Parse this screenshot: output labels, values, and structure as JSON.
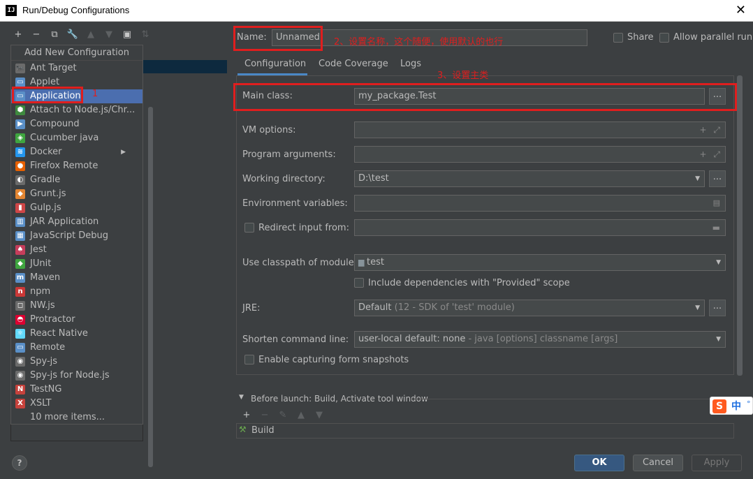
{
  "window": {
    "title": "Run/Debug Configurations",
    "logo": "IJ",
    "close_glyph": "✕"
  },
  "toolbar": {
    "icons": [
      {
        "name": "add-icon",
        "glyph": "+"
      },
      {
        "name": "remove-icon",
        "glyph": "−"
      },
      {
        "name": "copy-icon",
        "glyph": "⧉"
      },
      {
        "name": "wrench-icon",
        "glyph": "🔧"
      },
      {
        "name": "move-up-icon",
        "glyph": "▲"
      },
      {
        "name": "move-down-icon",
        "glyph": "▼"
      },
      {
        "name": "new-folder-icon",
        "glyph": "▣"
      },
      {
        "name": "sort-icon",
        "glyph": "⇅"
      }
    ]
  },
  "popup": {
    "header": "Add New Configuration",
    "items": [
      {
        "label": "Ant Target",
        "icon": "ant-icon",
        "glyph": "🐜",
        "color": "#6b6b6b"
      },
      {
        "label": "Applet",
        "icon": "applet-icon",
        "glyph": "▭",
        "color": "#5a8fc7"
      },
      {
        "label": "Application",
        "icon": "application-icon",
        "glyph": "▭",
        "color": "#5a8fc7"
      },
      {
        "label": "Attach to Node.js/Chr...",
        "icon": "attach-node-icon",
        "glyph": "⬢",
        "color": "#3f8a3f"
      },
      {
        "label": "Compound",
        "icon": "compound-icon",
        "glyph": "▶",
        "color": "#5a8fc7"
      },
      {
        "label": "Cucumber java",
        "icon": "cucumber-icon",
        "glyph": "◈",
        "color": "#3fa53f"
      },
      {
        "label": "Docker",
        "icon": "docker-icon",
        "glyph": "≋",
        "color": "#2496ed"
      },
      {
        "label": "Firefox Remote",
        "icon": "firefox-icon",
        "glyph": "●",
        "color": "#e66000"
      },
      {
        "label": "Gradle",
        "icon": "gradle-icon",
        "glyph": "◐",
        "color": "#6b6b6b"
      },
      {
        "label": "Grunt.js",
        "icon": "grunt-icon",
        "glyph": "◆",
        "color": "#e48632"
      },
      {
        "label": "Gulp.js",
        "icon": "gulp-icon",
        "glyph": "▮",
        "color": "#cf4647"
      },
      {
        "label": "JAR Application",
        "icon": "jar-icon",
        "glyph": "▥",
        "color": "#5a8fc7"
      },
      {
        "label": "JavaScript Debug",
        "icon": "js-debug-icon",
        "glyph": "▦",
        "color": "#5a8fc7"
      },
      {
        "label": "Jest",
        "icon": "jest-icon",
        "glyph": "♠",
        "color": "#c63d5b"
      },
      {
        "label": "JUnit",
        "icon": "junit-icon",
        "glyph": "◆",
        "color": "#3fa53f"
      },
      {
        "label": "Maven",
        "icon": "maven-icon",
        "glyph": "m",
        "color": "#5a8fc7"
      },
      {
        "label": "npm",
        "icon": "npm-icon",
        "glyph": "n",
        "color": "#cb3837"
      },
      {
        "label": "NW.js",
        "icon": "nwjs-icon",
        "glyph": "◻",
        "color": "#6b6b6b"
      },
      {
        "label": "Protractor",
        "icon": "protractor-icon",
        "glyph": "◓",
        "color": "#dd0031"
      },
      {
        "label": "React Native",
        "icon": "react-icon",
        "glyph": "⚛",
        "color": "#61dafb"
      },
      {
        "label": "Remote",
        "icon": "remote-icon",
        "glyph": "▭",
        "color": "#5a8fc7"
      },
      {
        "label": "Spy-js",
        "icon": "spyjs-icon",
        "glyph": "◉",
        "color": "#6b6b6b"
      },
      {
        "label": "Spy-js for Node.js",
        "icon": "spyjs-node-icon",
        "glyph": "◉",
        "color": "#6b6b6b"
      },
      {
        "label": "TestNG",
        "icon": "testng-icon",
        "glyph": "N",
        "color": "#c6423c"
      },
      {
        "label": "XSLT",
        "icon": "xslt-icon",
        "glyph": "X",
        "color": "#c6423c"
      },
      {
        "label": "10 more items...",
        "icon": "",
        "glyph": "",
        "color": ""
      }
    ],
    "selected_index": 2,
    "docker_has_submenu_glyph": "▶"
  },
  "form": {
    "name_label": "Name:",
    "name_value": "Unnamed",
    "share_label": "Share",
    "parallel_label": "Allow parallel run",
    "tabs": [
      "Configuration",
      "Code Coverage",
      "Logs"
    ],
    "main_class_label": "Main class:",
    "main_class_value": "my_package.Test",
    "vm_options_label": "VM options:",
    "program_args_label": "Program arguments:",
    "working_dir_label": "Working directory:",
    "working_dir_value": "D:\\test",
    "env_vars_label": "Environment variables:",
    "redirect_label": "Redirect input from:",
    "classpath_label": "Use classpath of module:",
    "classpath_value": "test",
    "provided_scope_label": "Include dependencies with \"Provided\" scope",
    "jre_label": "JRE:",
    "jre_value_main": "Default",
    "jre_value_hint": "(12 - SDK of 'test' module)",
    "shorten_label": "Shorten command line:",
    "shorten_value_main": "user-local default: none",
    "shorten_value_hint": "- java [options] classname [args]",
    "snapshots_label": "Enable capturing form snapshots",
    "ellipsis": "...",
    "expand_icons": "+ ⤢",
    "dropdown_glyph": "▼"
  },
  "before_launch": {
    "title": "Before launch: Build, Activate tool window",
    "expand_glyph": "▼",
    "tools": [
      {
        "name": "add-task-icon",
        "glyph": "+"
      },
      {
        "name": "remove-task-icon",
        "glyph": "−"
      },
      {
        "name": "edit-task-icon",
        "glyph": "✎"
      },
      {
        "name": "task-up-icon",
        "glyph": "▲"
      },
      {
        "name": "task-down-icon",
        "glyph": "▼"
      }
    ],
    "task_label": "Build",
    "task_glyph": "🔨"
  },
  "annotations": {
    "a1": "1",
    "a2": "2、设置名称，这个随便，使用默认的也行",
    "a3": "3、设置主类"
  },
  "buttons": {
    "ok": "OK",
    "cancel": "Cancel",
    "apply": "Apply",
    "help": "?"
  },
  "ime": {
    "logo": "S",
    "lang": "中",
    "dot": "°"
  }
}
